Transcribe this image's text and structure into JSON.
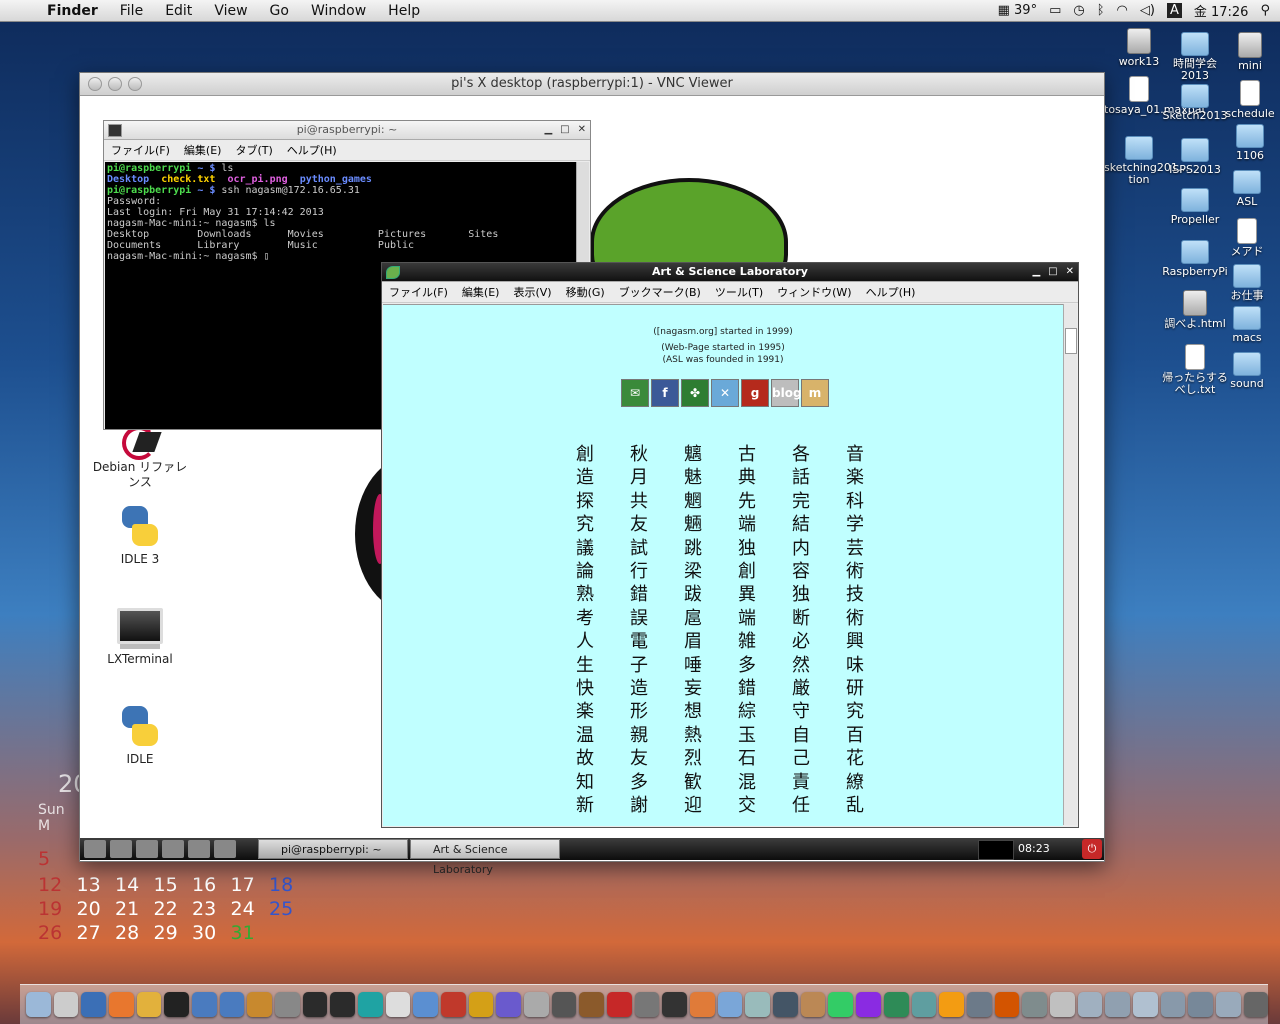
{
  "menubar": {
    "app": "Finder",
    "items": [
      "File",
      "Edit",
      "View",
      "Go",
      "Window",
      "Help"
    ],
    "temperature": "39°",
    "clock": "金 17:26"
  },
  "desktop_icons": [
    {
      "label": "work13"
    },
    {
      "label": "時間学会2013"
    },
    {
      "label": "mini"
    },
    {
      "label": "tosaya_01.maxpat"
    },
    {
      "label": "Sketch2013"
    },
    {
      "label": "schedule"
    },
    {
      "label": "1106"
    },
    {
      "label": "sketching201…tion"
    },
    {
      "label": "ISPS2013"
    },
    {
      "label": "ASL"
    },
    {
      "label": "Propeller"
    },
    {
      "label": "メアド"
    },
    {
      "label": "RaspberryPi"
    },
    {
      "label": "お仕事"
    },
    {
      "label": "調べよ.html"
    },
    {
      "label": "macs"
    },
    {
      "label": "帰ったらするべし.txt"
    },
    {
      "label": "sound"
    }
  ],
  "calendar": {
    "year_fragment": "20",
    "dow_fragment": "Sun  M",
    "rows": [
      [
        {
          "d": "5",
          "c": "red"
        }
      ],
      [
        {
          "d": "12",
          "c": "red"
        },
        {
          "d": "13"
        },
        {
          "d": "14"
        },
        {
          "d": "15"
        },
        {
          "d": "16"
        },
        {
          "d": "17"
        },
        {
          "d": "18",
          "c": "blue"
        }
      ],
      [
        {
          "d": "19",
          "c": "red"
        },
        {
          "d": "20"
        },
        {
          "d": "21"
        },
        {
          "d": "22"
        },
        {
          "d": "23"
        },
        {
          "d": "24"
        },
        {
          "d": "25",
          "c": "blue"
        }
      ],
      [
        {
          "d": "26",
          "c": "red"
        },
        {
          "d": "27"
        },
        {
          "d": "28"
        },
        {
          "d": "29"
        },
        {
          "d": "30"
        },
        {
          "d": "31",
          "c": "green"
        }
      ]
    ]
  },
  "vnc": {
    "title": "pi's X desktop (raspberrypi:1) - VNC Viewer"
  },
  "lx_icons": [
    {
      "label": "Debian リファレンス"
    },
    {
      "label": "IDLE 3"
    },
    {
      "label": "LXTerminal"
    },
    {
      "label": "IDLE"
    }
  ],
  "terminal": {
    "title": "pi@raspberrypi: ~",
    "menu": [
      "ファイル(F)",
      "編集(E)",
      "タブ(T)",
      "ヘルプ(H)"
    ],
    "lines": [
      {
        "seg": [
          {
            "t": "pi@raspberrypi",
            "c": "g1"
          },
          {
            "t": " ~ $ ",
            "c": "b1"
          },
          {
            "t": "ls"
          }
        ]
      },
      {
        "seg": [
          {
            "t": "Desktop",
            "c": "b1"
          },
          {
            "t": "  "
          },
          {
            "t": "check.txt",
            "c": "y1"
          },
          {
            "t": "  "
          },
          {
            "t": "ocr_pi.png",
            "c": "m1"
          },
          {
            "t": "  "
          },
          {
            "t": "python_games",
            "c": "b1"
          }
        ]
      },
      {
        "seg": [
          {
            "t": "pi@raspberrypi",
            "c": "g1"
          },
          {
            "t": " ~ $ ",
            "c": "b1"
          },
          {
            "t": "ssh nagasm@172.16.65.31"
          }
        ]
      },
      {
        "seg": [
          {
            "t": "Password:"
          }
        ]
      },
      {
        "seg": [
          {
            "t": "Last login: Fri May 31 17:14:42 2013"
          }
        ]
      },
      {
        "seg": [
          {
            "t": "nagasm-Mac-mini:~ nagasm$ ls"
          }
        ]
      },
      {
        "seg": [
          {
            "t": "Desktop        Downloads      Movies         Pictures       Sites"
          }
        ]
      },
      {
        "seg": [
          {
            "t": "Documents      Library        Music          Public"
          }
        ]
      },
      {
        "seg": [
          {
            "t": "nagasm-Mac-mini:~ nagasm$ ▯"
          }
        ]
      }
    ]
  },
  "browser": {
    "title": "Art & Science Laboratory",
    "menu": [
      "ファイル(F)",
      "編集(E)",
      "表示(V)",
      "移動(G)",
      "ブックマーク(B)",
      "ツール(T)",
      "ウィンドウ(W)",
      "ヘルプ(H)"
    ],
    "line1": "([nagasm.org] started in 1999)",
    "line2": "(Web-Page started in 1995)",
    "line3": "(ASL was founded in 1991)",
    "badges": [
      {
        "label": "✉",
        "color": "#3a8a3a"
      },
      {
        "label": "f",
        "color": "#3b5998"
      },
      {
        "label": "✤",
        "color": "#2e7d32"
      },
      {
        "label": "✕",
        "color": "#6aa9d8"
      },
      {
        "label": "g",
        "color": "#b52a1c"
      },
      {
        "label": "blog",
        "color": "#bdbdbd"
      },
      {
        "label": "m",
        "color": "#d8b36a"
      }
    ],
    "kanji_columns": [
      "創造探究議論熟考人生快楽温故知新",
      "秋月共友試行錯誤電子造形親友多謝",
      "魑魅魍魎跳梁跋扈眉唾妄想熱烈歓迎",
      "古典先端独創異端雑多錯綜玉石混交",
      "各話完結内容独断必然厳守自己責任",
      "音楽科学芸術技術興味研究百花繚乱"
    ]
  },
  "lxpanel": {
    "tasks": [
      {
        "label": "pi@raspberrypi: ~"
      },
      {
        "label": "Art & Science Laboratory"
      }
    ],
    "clock": "08:23"
  },
  "dock": {
    "colors": [
      "#9bb8d8",
      "#ccc",
      "#3b6fb6",
      "#e8772e",
      "#e2b13c",
      "#222",
      "#4a7bbf",
      "#4a7bbf",
      "#c8892e",
      "#888",
      "#2b2b2b",
      "#2b2b2b",
      "#1fa3a3",
      "#ddd",
      "#5b8fd1",
      "#c0392b",
      "#d4a017",
      "#6a5acd",
      "#aaa",
      "#555",
      "#8b5a2b",
      "#c62828",
      "#777",
      "#333",
      "#e07b39",
      "#7aa6d8",
      "#9bb",
      "#456",
      "#b85",
      "#3c6",
      "#8a2be2",
      "#2e8b57",
      "#5f9ea0",
      "#f39c12",
      "#6c7a89",
      "#d35400",
      "#7f8c8d",
      "#c0c0c0",
      "#a0b0c0",
      "#90a0b0",
      "#b0c0d0",
      "#8899aa",
      "#778899",
      "#99aabb",
      "#666"
    ]
  }
}
